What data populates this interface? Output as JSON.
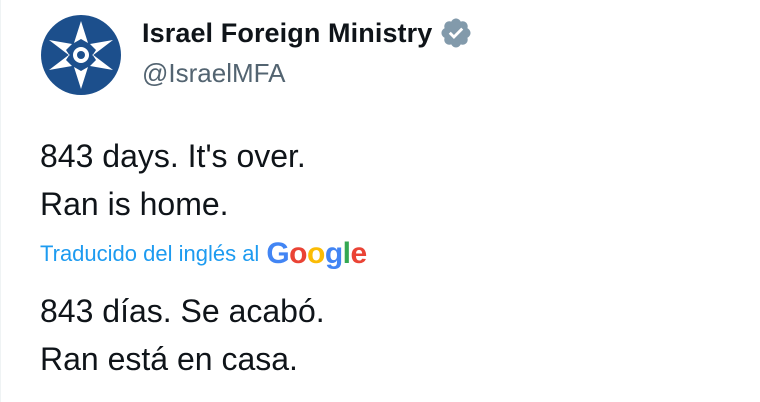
{
  "account": {
    "display_name": "Israel Foreign Ministry",
    "handle": "@IsraelMFA",
    "verified_badge_icon": "verified-badge-icon",
    "avatar_icon": "israel-mfa-logo"
  },
  "tweet": {
    "original_lines": [
      "843 days. It's over.",
      "Ran is home."
    ],
    "translation_label": "Traducido del inglés al",
    "translation_provider": "Google",
    "translated_lines": [
      "843 días. Se acabó.",
      "Ran está en casa."
    ]
  },
  "colors": {
    "link": "#1d9bf0",
    "secondary_text": "#536471",
    "badge": "#829aab",
    "logo_blue": "#1c4f8c"
  }
}
